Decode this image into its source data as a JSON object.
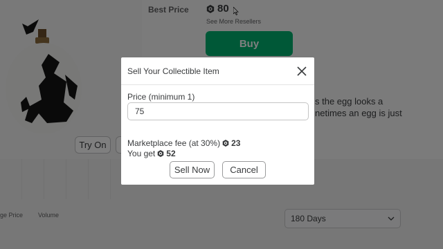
{
  "item": {
    "best_price_label": "Best Price",
    "best_price": "80",
    "see_more": "See More Resellers",
    "buy_label": "Buy",
    "try_on_label": "Try On",
    "description_lines": [
      "s the egg looks a",
      "netimes an egg is just"
    ]
  },
  "chart": {
    "legend_price": "ge Price",
    "legend_volume": "Volume",
    "range_select": "180 Days"
  },
  "modal": {
    "title": "Sell Your Collectible Item",
    "price_label": "Price (minimum 1)",
    "price_value": "75",
    "fee_label": "Marketplace fee (at 30%)",
    "fee_value": "23",
    "you_get_label": "You get",
    "you_get_value": "52",
    "sell_button": "Sell Now",
    "cancel_button": "Cancel"
  },
  "icons": {
    "currency": "robux-icon",
    "close": "close-icon",
    "dropdown": "chevron-down-icon",
    "cursor": "mouse-cursor-icon"
  },
  "colors": {
    "buy_button": "#00b06f",
    "overlay": "rgba(0,0,0,0.5)",
    "text": "#393b3d"
  }
}
